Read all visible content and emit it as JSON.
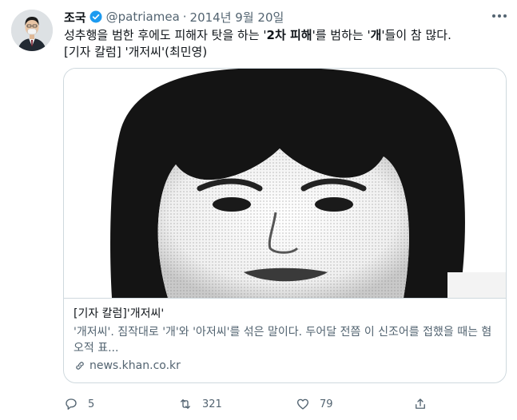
{
  "tweet": {
    "author_name": "조국",
    "handle": "@patriamea",
    "separator": "·",
    "date": "2014년 9월 20일",
    "text_line1_part1": "성추행을 범한 후에도 피해자 탓을 하는 '",
    "text_line1_bold1": "2차 피해",
    "text_line1_part2": "'를 범하는 '",
    "text_line1_bold2": "개",
    "text_line1_part3": "'들이 참 많다.",
    "text_line2": "[기자 칼럼] '개저씨'(최민영)"
  },
  "card": {
    "title": "[기자 칼럼]'개저씨'",
    "description": "'개저씨'. 짐작대로 '개'와 '아저씨'를 섞은 말이다. 두어달 전쯤 이 신조어를 접했을 때는 혐오적 표...",
    "domain": "news.khan.co.kr"
  },
  "actions": {
    "reply_count": "5",
    "retweet_count": "321",
    "like_count": "79"
  },
  "icons": {
    "verified": "verified-badge-icon",
    "more": "more-icon",
    "link": "link-icon",
    "reply": "reply-icon",
    "retweet": "retweet-icon",
    "like": "like-icon",
    "share": "share-icon"
  },
  "colors": {
    "verified_blue": "#1d9bf0",
    "text": "#0f1419",
    "muted": "#536471",
    "border": "#cfd9de"
  }
}
